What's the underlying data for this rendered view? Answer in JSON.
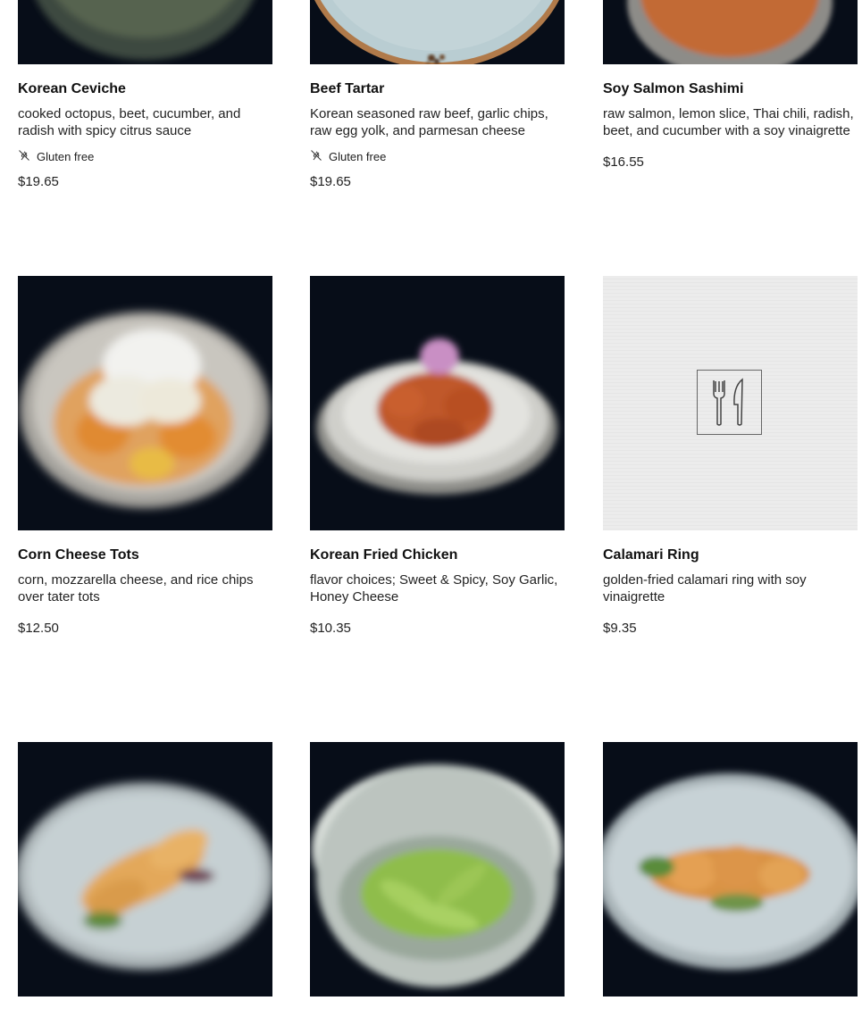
{
  "menu_items": [
    {
      "name": "Korean Ceviche",
      "description": "cooked octopus, beet, cucumber, and radish with spicy citrus sauce",
      "tag": "Gluten free",
      "price": "$19.65"
    },
    {
      "name": "Beef Tartar",
      "description": "Korean seasoned raw beef, garlic chips, raw egg yolk, and parmesan cheese",
      "tag": "Gluten free",
      "price": "$19.65"
    },
    {
      "name": "Soy Salmon Sashimi",
      "description": "raw salmon, lemon slice, Thai chili, radish, beet, and cucumber with a soy vinaigrette",
      "price": "$16.55"
    },
    {
      "name": "Corn Cheese Tots",
      "description": "corn, mozzarella cheese, and rice chips over tater tots",
      "price": "$12.50"
    },
    {
      "name": "Korean Fried Chicken",
      "description": "flavor choices; Sweet & Spicy, Soy Garlic, Honey Cheese",
      "price": "$10.35"
    },
    {
      "name": "Calamari Ring",
      "description": "golden-fried calamari ring with soy vinaigrette",
      "price": "$9.35"
    }
  ],
  "icons": {
    "gluten_free": "no-wheat-icon",
    "placeholder": "fork-knife-icon"
  },
  "colors": {
    "photo_background": "#070d18",
    "placeholder_background": "#ececec"
  }
}
